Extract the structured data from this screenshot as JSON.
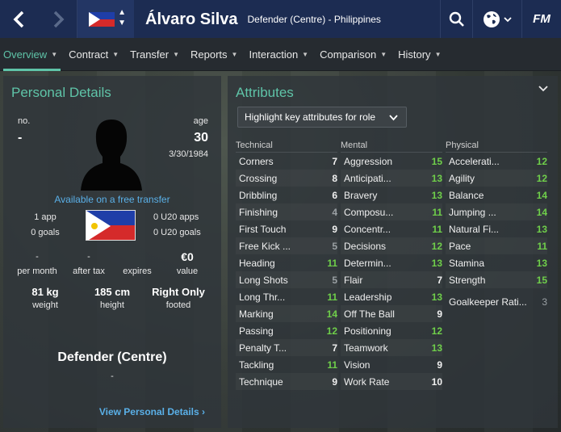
{
  "header": {
    "back_icon": "chevron-left-icon",
    "forward_icon": "chevron-right-icon",
    "player_name": "Álvaro Silva",
    "player_subtitle": "Defender (Centre) - Philippines",
    "search_icon": "search-icon",
    "globe_icon": "globe-icon",
    "logo": "FM"
  },
  "menu": {
    "items": [
      {
        "label": "Overview",
        "active": true
      },
      {
        "label": "Contract"
      },
      {
        "label": "Transfer"
      },
      {
        "label": "Reports"
      },
      {
        "label": "Interaction"
      },
      {
        "label": "Comparison"
      },
      {
        "label": "History"
      }
    ]
  },
  "personal": {
    "title": "Personal Details",
    "no_label": "no.",
    "no_value": "-",
    "age_label": "age",
    "age_value": "30",
    "dob": "3/30/1984",
    "transfer_status": "Available on a free transfer",
    "apps": "1 app",
    "goals": "0 goals",
    "u20_apps": "0 U20 apps",
    "u20_goals": "0 U20 goals",
    "per_month_value": "-",
    "per_month_label": "per month",
    "after_tax_value": "-",
    "after_tax_label": "after tax",
    "expires_value": "",
    "expires_label": "expires",
    "value_value": "€0",
    "value_label": "value",
    "weight_value": "81 kg",
    "weight_label": "weight",
    "height_value": "185 cm",
    "height_label": "height",
    "foot_value": "Right Only",
    "foot_label": "footed",
    "position": "Defender (Centre)",
    "position_sub": "-",
    "view_link": "View Personal Details ›"
  },
  "attributes": {
    "title": "Attributes",
    "role_button": "Highlight key attributes for role",
    "columns": [
      {
        "heading": "Technical",
        "rows": [
          {
            "name": "Corners",
            "value": "7"
          },
          {
            "name": "Crossing",
            "value": "8"
          },
          {
            "name": "Dribbling",
            "value": "6"
          },
          {
            "name": "Finishing",
            "value": "4"
          },
          {
            "name": "First Touch",
            "value": "9"
          },
          {
            "name": "Free Kick ...",
            "value": "5"
          },
          {
            "name": "Heading",
            "value": "11"
          },
          {
            "name": "Long Shots",
            "value": "5"
          },
          {
            "name": "Long Thr...",
            "value": "11"
          },
          {
            "name": "Marking",
            "value": "14"
          },
          {
            "name": "Passing",
            "value": "12"
          },
          {
            "name": "Penalty T...",
            "value": "7"
          },
          {
            "name": "Tackling",
            "value": "11"
          },
          {
            "name": "Technique",
            "value": "9"
          }
        ]
      },
      {
        "heading": "Mental",
        "rows": [
          {
            "name": "Aggression",
            "value": "15"
          },
          {
            "name": "Anticipati...",
            "value": "13"
          },
          {
            "name": "Bravery",
            "value": "13"
          },
          {
            "name": "Composu...",
            "value": "11"
          },
          {
            "name": "Concentr...",
            "value": "11"
          },
          {
            "name": "Decisions",
            "value": "12"
          },
          {
            "name": "Determin...",
            "value": "13"
          },
          {
            "name": "Flair",
            "value": "7"
          },
          {
            "name": "Leadership",
            "value": "13"
          },
          {
            "name": "Off The Ball",
            "value": "9"
          },
          {
            "name": "Positioning",
            "value": "12"
          },
          {
            "name": "Teamwork",
            "value": "13"
          },
          {
            "name": "Vision",
            "value": "9"
          },
          {
            "name": "Work Rate",
            "value": "10"
          }
        ]
      },
      {
        "heading": "Physical",
        "rows": [
          {
            "name": "Accelerati...",
            "value": "12"
          },
          {
            "name": "Agility",
            "value": "12"
          },
          {
            "name": "Balance",
            "value": "14"
          },
          {
            "name": "Jumping ...",
            "value": "14"
          },
          {
            "name": "Natural Fi...",
            "value": "13"
          },
          {
            "name": "Pace",
            "value": "11"
          },
          {
            "name": "Stamina",
            "value": "13"
          },
          {
            "name": "Strength",
            "value": "15"
          }
        ],
        "extra": {
          "name": "Goalkeeper Rati...",
          "value": "3"
        }
      }
    ]
  },
  "colors": {
    "accent": "#5fc4a8",
    "link": "#5ab0e8",
    "header_bg": "#1c2c52",
    "value_green": "#6fcf4a"
  }
}
